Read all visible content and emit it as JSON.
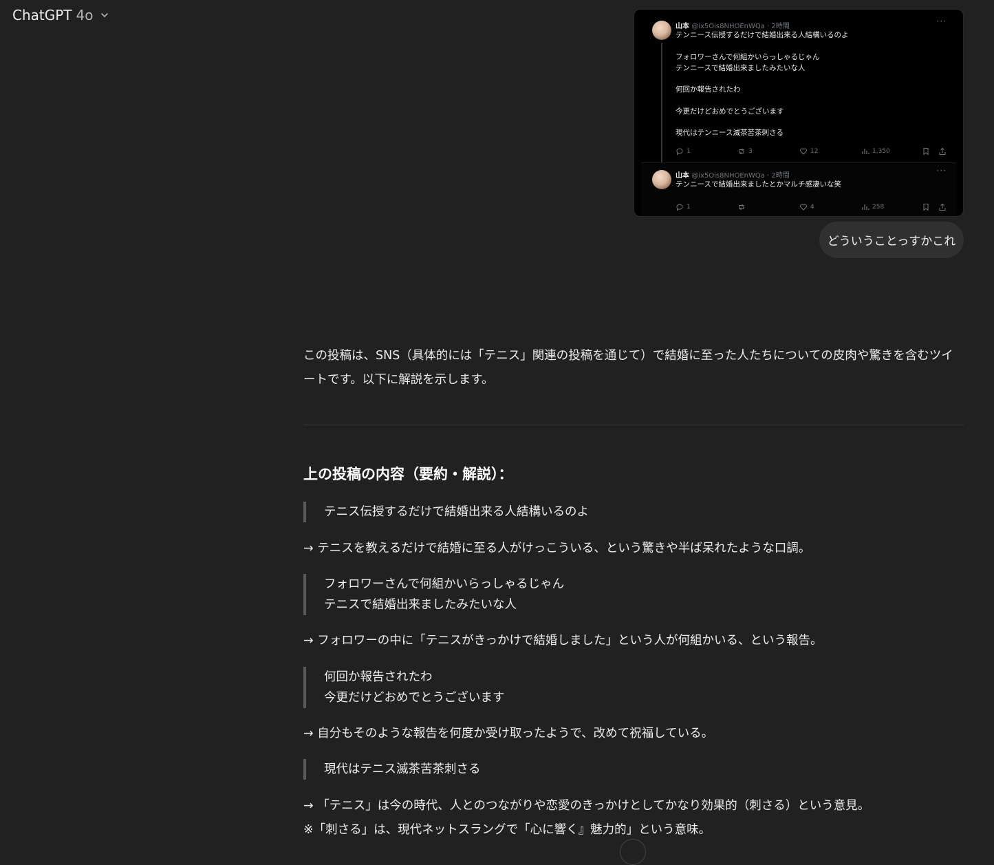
{
  "header": {
    "app": "ChatGPT",
    "model": "4o"
  },
  "tweets": [
    {
      "name": "山本",
      "handle": "@ix5Ois8NHOEnWQa · 2時間",
      "lines": [
        "テンニース伝授するだけで結婚出来る人結構いるのよ",
        "",
        "フォロワーさんで何組かいらっしゃるじゃん",
        "テンニースで結婚出来ましたみたいな人",
        "",
        "何回か報告されたわ",
        "",
        "今更だけどおめでとうございます",
        "",
        "現代はテンニース滅茶苦茶刺さる"
      ],
      "stats": {
        "reply": "1",
        "retweet": "3",
        "like": "12",
        "views": "1,350"
      }
    },
    {
      "name": "山本",
      "handle": "@ix5Ois8NHOEnWQa · 2時間",
      "lines": [
        "テンニースで結婚出来ましたとかマルチ感凄いな笑"
      ],
      "stats": {
        "reply": "1",
        "retweet": "",
        "like": "4",
        "views": "258"
      }
    }
  ],
  "user_message": "どういうことっすかこれ",
  "assistant": {
    "intro": "この投稿は、SNS（具体的には「テニス」関連の投稿を通じて）で結婚に至った人たちについての皮肉や驚きを含むツイートです。以下に解説を示します。",
    "heading": "上の投稿の内容（要約・解説）：",
    "quote1": [
      "テニス伝授するだけで結婚出来る人結構いるのよ"
    ],
    "para1": "→ テニスを教えるだけで結婚に至る人がけっこういる、という驚きや半ば呆れたような口調。",
    "quote2": [
      "フォロワーさんで何組かいらっしゃるじゃん",
      "テニスで結婚出来ましたみたいな人"
    ],
    "para2": "→ フォロワーの中に「テニスがきっかけで結婚しました」という人が何組かいる、という報告。",
    "quote3": [
      "何回か報告されたわ",
      "今更だけどおめでとうございます"
    ],
    "para3": "→ 自分もそのような報告を何度か受け取ったようで、改めて祝福している。",
    "quote4": [
      "現代はテニス滅茶苦茶刺さる"
    ],
    "para4": "→ 「テニス」は今の時代、人とのつながりや恋愛のきっかけとしてかなり効果的（刺さる）という意見。",
    "para5": "※「刺さる」は、現代ネットスラングで「心に響く』魅力的」という意味。"
  }
}
